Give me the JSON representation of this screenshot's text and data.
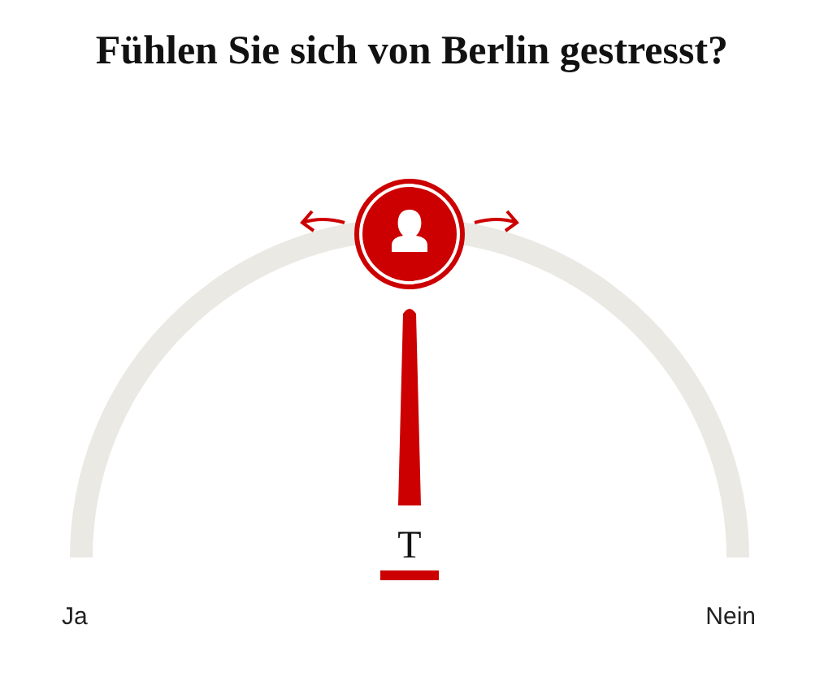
{
  "title": "Fühlen Sie sich von Berlin gestresst?",
  "gauge": {
    "marker": "T",
    "min_label": "Ja",
    "max_label": "Nein"
  }
}
